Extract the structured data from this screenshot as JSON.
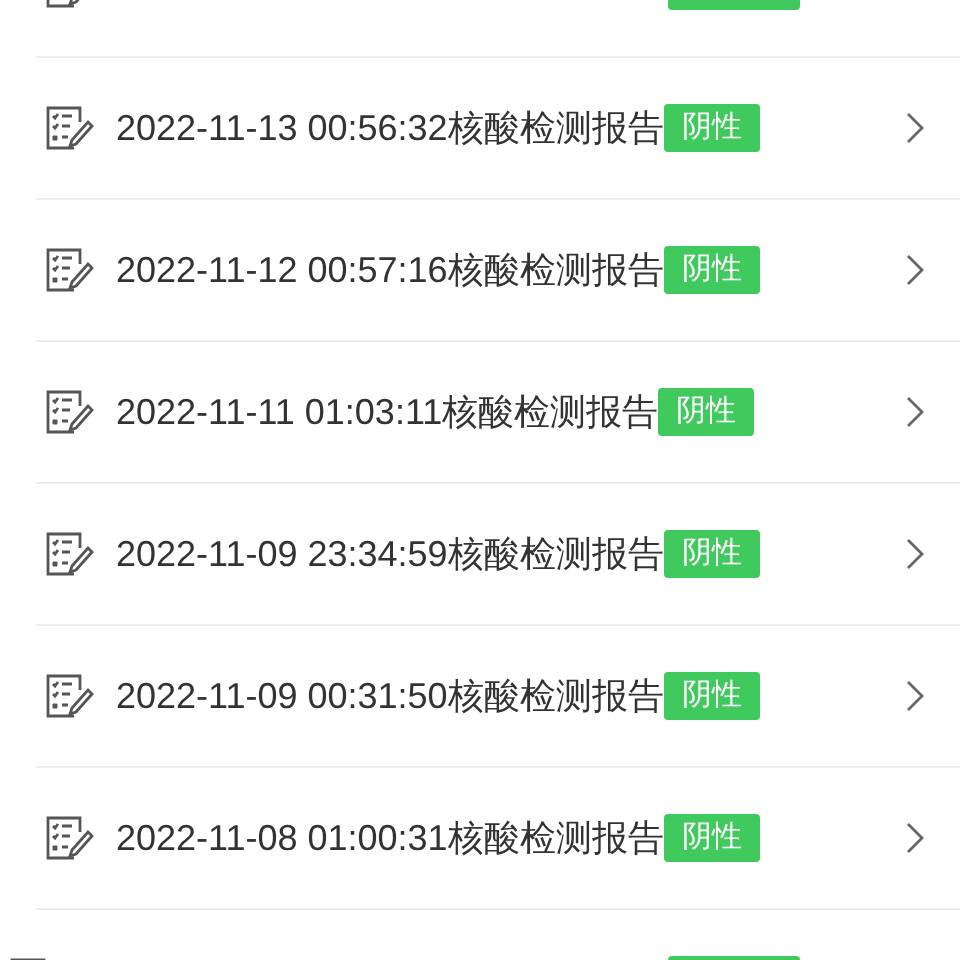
{
  "reports": [
    {
      "kind": "clipped"
    },
    {
      "kind": "full",
      "title": "2022-11-13 00:56:32核酸检测报告",
      "result": "阴性"
    },
    {
      "kind": "full",
      "title": "2022-11-12 00:57:16核酸检测报告",
      "result": "阴性"
    },
    {
      "kind": "full",
      "title": "2022-11-11 01:03:11核酸检测报告",
      "result": "阴性"
    },
    {
      "kind": "full",
      "title": "2022-11-09 23:34:59核酸检测报告",
      "result": "阴性"
    },
    {
      "kind": "full",
      "title": "2022-11-09 00:31:50核酸检测报告",
      "result": "阴性"
    },
    {
      "kind": "full",
      "title": "2022-11-08 01:00:31核酸检测报告",
      "result": "阴性"
    },
    {
      "kind": "clipped"
    }
  ]
}
